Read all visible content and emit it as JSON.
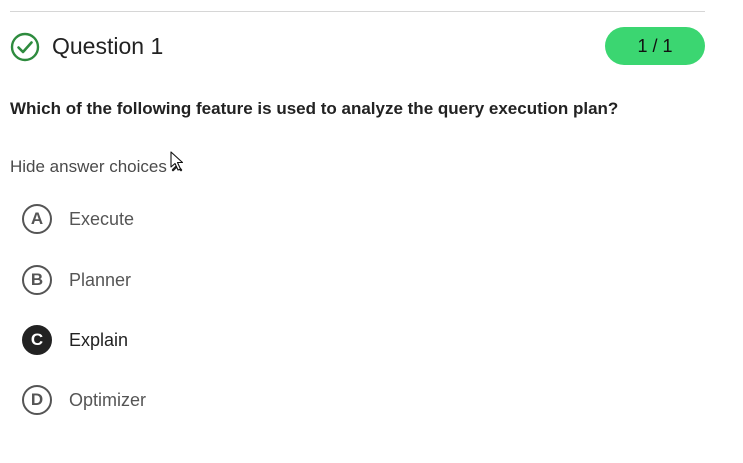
{
  "header": {
    "question_title": "Question 1",
    "score": "1 / 1",
    "status_icon": "check-circle-icon",
    "accent_color": "#3bd671",
    "check_color": "#2e8b3e"
  },
  "question_text": "Which of the following feature is used to analyze the query execution plan?",
  "toggle_label": "Hide answer choices",
  "choices": [
    {
      "letter": "A",
      "label": "Execute",
      "selected": false
    },
    {
      "letter": "B",
      "label": "Planner",
      "selected": false
    },
    {
      "letter": "C",
      "label": "Explain",
      "selected": true
    },
    {
      "letter": "D",
      "label": "Optimizer",
      "selected": false
    }
  ]
}
